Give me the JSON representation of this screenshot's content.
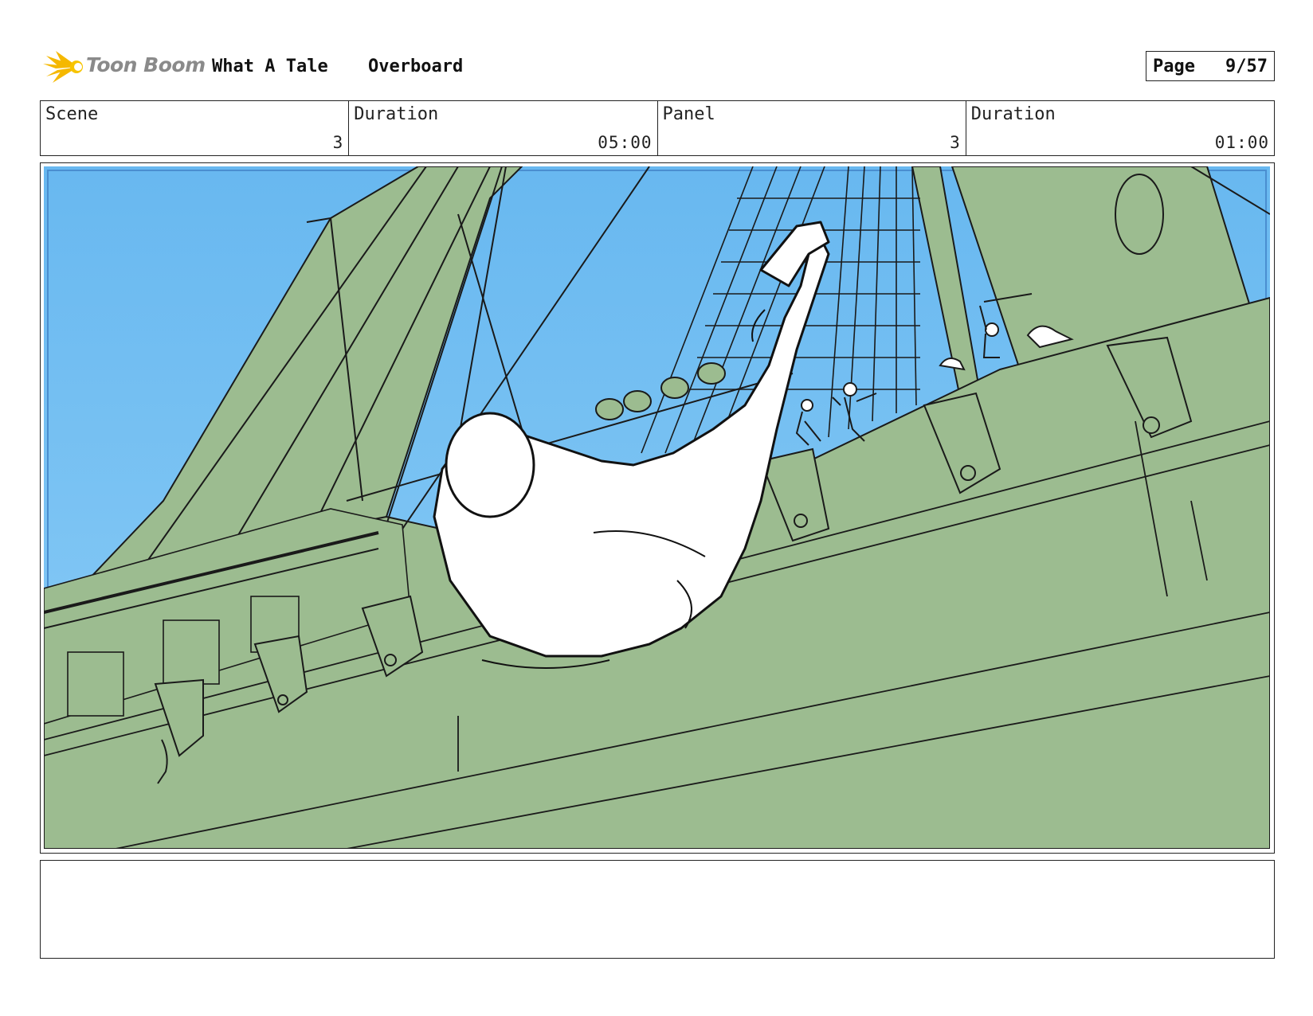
{
  "header": {
    "logo_text": "Toon Boom",
    "project_title": "What A Tale",
    "episode_title": "Overboard",
    "page_label": "Page",
    "page_number": "9/57"
  },
  "info": {
    "scene_label": "Scene",
    "scene_value": "3",
    "scene_duration_label": "Duration",
    "scene_duration_value": "05:00",
    "panel_label": "Panel",
    "panel_value": "3",
    "panel_duration_label": "Duration",
    "panel_duration_value": "01:00"
  },
  "panel": {
    "sky_color": "#6fbdf2",
    "hull_color": "#9cbc90",
    "line_color": "#1a1a1a"
  },
  "notes": {
    "text": ""
  }
}
